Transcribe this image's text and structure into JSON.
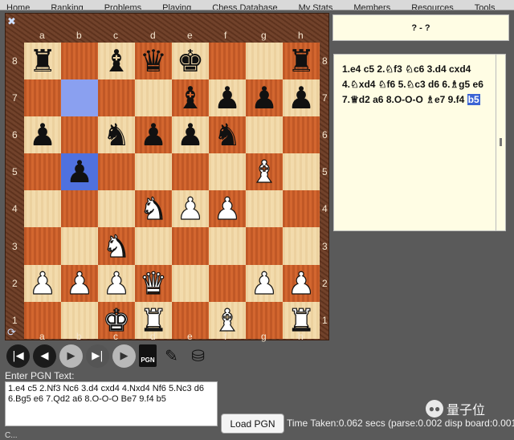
{
  "nav": {
    "items": [
      "Home",
      "Ranking",
      "Problems",
      "Playing",
      "Chess Database",
      "My Stats",
      "Members",
      "Resources",
      "Tools"
    ]
  },
  "board": {
    "files": [
      "a",
      "b",
      "c",
      "d",
      "e",
      "f",
      "g",
      "h"
    ],
    "ranks": [
      "8",
      "7",
      "6",
      "5",
      "4",
      "3",
      "2",
      "1"
    ],
    "position": [
      [
        "br",
        "",
        "bb",
        "bq",
        "bk",
        "",
        "",
        "br"
      ],
      [
        "",
        "",
        "",
        "",
        "bb",
        "bp",
        "bp",
        "bp"
      ],
      [
        "bp",
        "",
        "bn",
        "bp",
        "bp",
        "bn",
        "",
        ""
      ],
      [
        "",
        "bp",
        "",
        "",
        "",
        "",
        "wb",
        ""
      ],
      [
        "",
        "",
        "",
        "wn",
        "wp",
        "wp",
        "",
        ""
      ],
      [
        "",
        "",
        "wn",
        "",
        "",
        "",
        "",
        ""
      ],
      [
        "wp",
        "wp",
        "wp",
        "wq",
        "",
        "",
        "wp",
        "wp"
      ],
      [
        "",
        "",
        "wk",
        "wr",
        "",
        "wb",
        "",
        "wr"
      ]
    ],
    "last_move_from": "b7",
    "last_move_to": "b5"
  },
  "result": "? - ?",
  "moves": [
    "1.e4",
    "c5",
    "2.♘f3",
    "♘c6",
    "3.d4",
    "cxd4",
    "4.♘xd4",
    "♘f6",
    "5.♘c3",
    "d6",
    "6.♗g5",
    "e6",
    "7.♕d2",
    "a6",
    "8.O-O-O",
    "♗e7",
    "9.f4",
    "b5"
  ],
  "current_move": "b5",
  "pgn_label": "Enter PGN Text:",
  "pgn_text": "1.e4 c5 2.Nf3 Nc6 3.d4 cxd4 4.Nxd4 Nf6 5.Nc3 d6 6.Bg5 e6 7.Qd2 a6 8.O-O-O Be7 9.f4 b5",
  "load_button": "Load PGN",
  "time_text": "Time Taken:0.062 secs (parse:0.002 disp board:0.001",
  "watermark": "量子位",
  "pgn_icon_label": "PGN",
  "bottom_text": "C..."
}
